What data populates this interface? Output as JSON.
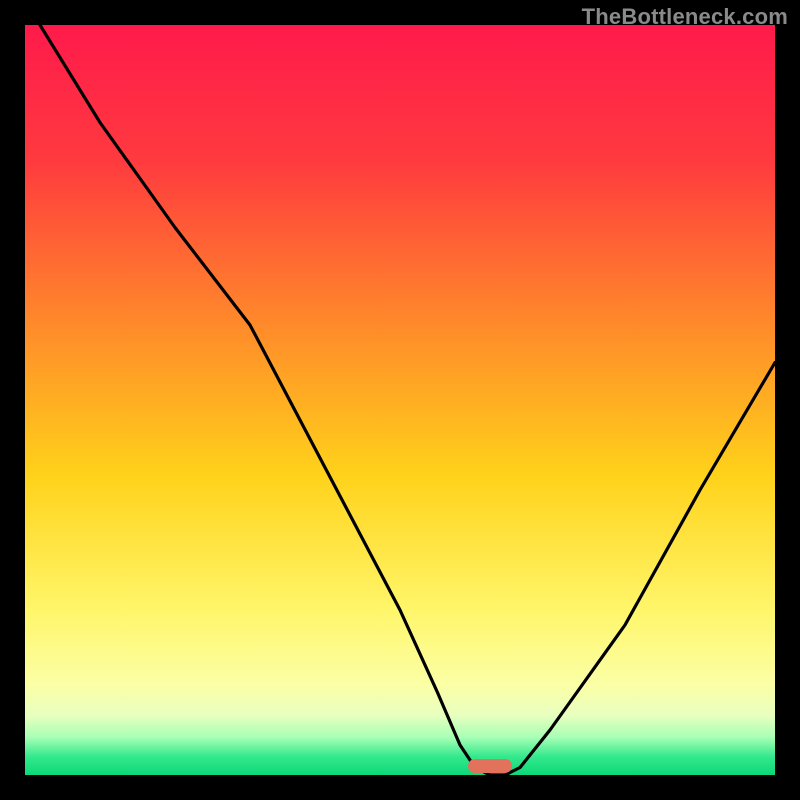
{
  "watermark": "TheBottleneck.com",
  "gradient_stops": [
    {
      "offset": 0,
      "color": "#ff1a4b"
    },
    {
      "offset": 0.18,
      "color": "#ff3a3f"
    },
    {
      "offset": 0.4,
      "color": "#ff8a2a"
    },
    {
      "offset": 0.6,
      "color": "#ffd21a"
    },
    {
      "offset": 0.78,
      "color": "#fff66a"
    },
    {
      "offset": 0.88,
      "color": "#fbffa6"
    },
    {
      "offset": 0.92,
      "color": "#e8ffbf"
    },
    {
      "offset": 0.95,
      "color": "#a6ffb5"
    },
    {
      "offset": 0.975,
      "color": "#35e98d"
    },
    {
      "offset": 1.0,
      "color": "#0bd977"
    }
  ],
  "marker": {
    "x_pct": 62,
    "color": "#e2725b"
  },
  "chart_data": {
    "type": "line",
    "title": "",
    "xlabel": "",
    "ylabel": "",
    "xlim": [
      0,
      100
    ],
    "ylim": [
      0,
      100
    ],
    "series": [
      {
        "name": "curve",
        "x": [
          2,
          10,
          20,
          30,
          40,
          50,
          55,
          58,
          60,
          62,
          64,
          66,
          70,
          80,
          90,
          100
        ],
        "y": [
          100,
          87,
          73,
          60,
          41,
          22,
          11,
          4,
          1,
          0,
          0,
          1,
          6,
          20,
          38,
          55
        ]
      }
    ]
  }
}
